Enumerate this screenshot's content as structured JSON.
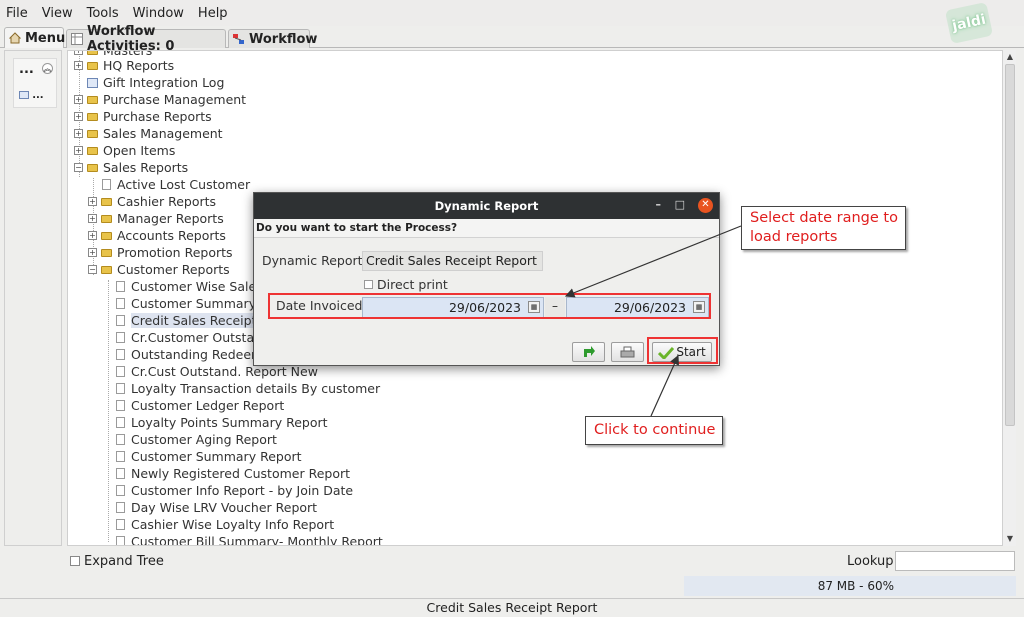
{
  "menubar": {
    "items": [
      "File",
      "View",
      "Tools",
      "Window",
      "Help"
    ]
  },
  "brand": {
    "text": "jaldi"
  },
  "tabs": [
    {
      "label": "Menu",
      "active": true
    },
    {
      "label": "Workflow Activities: 0",
      "active": false
    },
    {
      "label": "Workflow",
      "active": false
    }
  ],
  "left_panel": {
    "dots": "...",
    "item_dots": "..."
  },
  "tree": [
    {
      "label": "Masters"
    },
    {
      "label": "HQ Reports"
    },
    {
      "label": "Gift Integration Log"
    },
    {
      "label": "Purchase Management"
    },
    {
      "label": "Purchase Reports"
    },
    {
      "label": "Sales Management"
    },
    {
      "label": "Open Items"
    },
    {
      "label": "Sales Reports"
    },
    {
      "label": "Active Lost Customer"
    },
    {
      "label": "Cashier Reports"
    },
    {
      "label": "Manager Reports"
    },
    {
      "label": "Accounts Reports"
    },
    {
      "label": "Promotion Reports"
    },
    {
      "label": "Customer Reports"
    },
    {
      "label": "Customer Wise Sales"
    },
    {
      "label": "Customer Summary"
    },
    {
      "label": "Credit Sales Receipt"
    },
    {
      "label": "Cr.Customer Outstan"
    },
    {
      "label": "Outstanding Redeem"
    },
    {
      "label": "Cr.Cust Outstand. Report New"
    },
    {
      "label": "Loyalty Transaction details By customer"
    },
    {
      "label": "Customer Ledger Report"
    },
    {
      "label": "Loyalty Points Summary Report"
    },
    {
      "label": "Customer Aging Report"
    },
    {
      "label": "Customer Summary Report"
    },
    {
      "label": "Newly Registered Customer Report"
    },
    {
      "label": "Customer Info Report - by Join Date"
    },
    {
      "label": "Day Wise LRV Voucher Report"
    },
    {
      "label": "Cashier Wise Loyalty Info Report"
    },
    {
      "label": "Customer Bill Summary- Monthly Report"
    }
  ],
  "bottom": {
    "expand_tree": "Expand Tree",
    "lookup": "Lookup",
    "lookup_value": ""
  },
  "memory": "87 MB - 60%",
  "status": "Credit Sales Receipt Report",
  "dialog": {
    "title": "Dynamic Report",
    "minimize": "–",
    "maximize": "□",
    "close": "✕",
    "question": "Do you want to start the Process?",
    "report_label": "Dynamic Report",
    "report_value": "Credit Sales Receipt Report",
    "direct_print": "Direct print",
    "date_label": "Date Invoiced",
    "date_from": "29/06/2023",
    "date_to": "29/06/2023",
    "dash": "–",
    "start_label": "Start"
  },
  "annotations": {
    "select_date": "Select date range to load reports",
    "click_continue": "Click to continue"
  },
  "colors": {
    "highlight_red": "#e33333",
    "date_field": "#dbe5f4",
    "titlebar": "#2e3133"
  }
}
